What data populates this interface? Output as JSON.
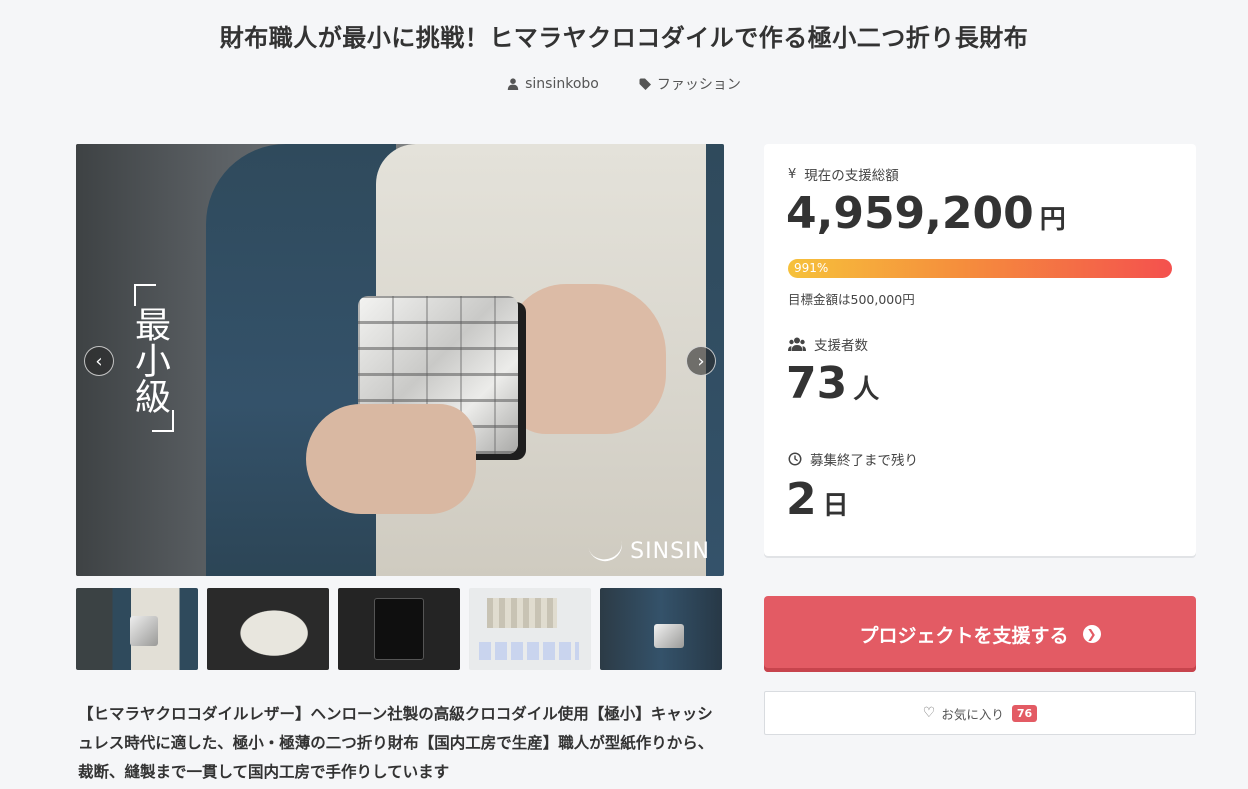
{
  "project": {
    "title": "財布職人が最小に挑戦！ヒマラヤクロコダイルで作る極小二つ折り長財布",
    "author": "sinsinkobo",
    "category": "ファッション",
    "author_icon": "user-icon",
    "category_icon": "tag-icon"
  },
  "gallery": {
    "overlay_text": "最小級",
    "brand_text": "SINSIN",
    "prev_icon": "chevron-left-icon",
    "next_icon": "chevron-right-icon",
    "prev_glyph": "‹",
    "next_glyph": "›",
    "thumbnail_count": 5
  },
  "description": "【ヒマラヤクロコダイルレザー】ヘンローン社製の高級クロコダイル使用【極小】キャッシュレス時代に適した、極小・極薄の二つ折り財布【国内工房で生産】職人が型紙作りから、裁断、縫製まで一貫して国内工房で手作りしています",
  "stats": {
    "total_label": "現在の支援総額",
    "total_icon": "yen-icon",
    "total_value": "4,959,200",
    "total_unit": "円",
    "progress_label": "991%",
    "progress_percent": 991,
    "goal_text": "目標金額は500,000円",
    "backers_label": "支援者数",
    "backers_icon": "users-icon",
    "backers_value": "73",
    "backers_unit": "人",
    "remaining_label": "募集終了まで残り",
    "remaining_icon": "clock-icon",
    "remaining_value": "2",
    "remaining_unit": "日"
  },
  "actions": {
    "support_label": "プロジェクトを支援する",
    "support_icon": "arrow-circle-right-icon",
    "favorite_label": "お気に入り",
    "favorite_icon": "heart-icon",
    "favorite_count": "76"
  },
  "colors": {
    "accent": "#e35b64",
    "progress_start": "#f6c13b",
    "progress_end": "#f4514e",
    "background": "#f5f6f8"
  }
}
